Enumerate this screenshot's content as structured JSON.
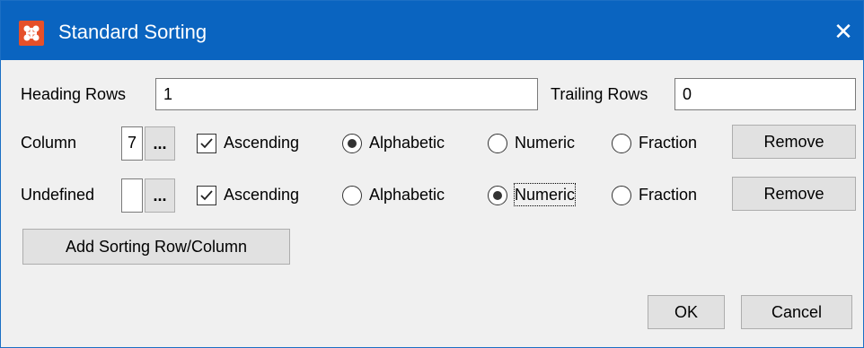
{
  "window": {
    "title": "Standard Sorting",
    "close_symbol": "✕"
  },
  "heading_rows": {
    "label": "Heading Rows",
    "value": "1"
  },
  "trailing_rows": {
    "label": "Trailing Rows",
    "value": "0"
  },
  "sort_rows": [
    {
      "name": "Column",
      "index_value": "7",
      "browse_label": "...",
      "ascending_label": "Ascending",
      "ascending_checked": true,
      "alphabetic_label": "Alphabetic",
      "numeric_label": "Numeric",
      "fraction_label": "Fraction",
      "selected_type": "Alphabetic",
      "remove_label": "Remove"
    },
    {
      "name": "Undefined",
      "index_value": "",
      "browse_label": "...",
      "ascending_label": "Ascending",
      "ascending_checked": true,
      "alphabetic_label": "Alphabetic",
      "numeric_label": "Numeric",
      "fraction_label": "Fraction",
      "selected_type": "Numeric",
      "remove_label": "Remove"
    }
  ],
  "add_button_label": "Add Sorting Row/Column",
  "ok_label": "OK",
  "cancel_label": "Cancel",
  "colors": {
    "titlebar": "#0a64c0",
    "app_icon": "#e5502a",
    "dialog_bg": "#f0f0f0"
  }
}
